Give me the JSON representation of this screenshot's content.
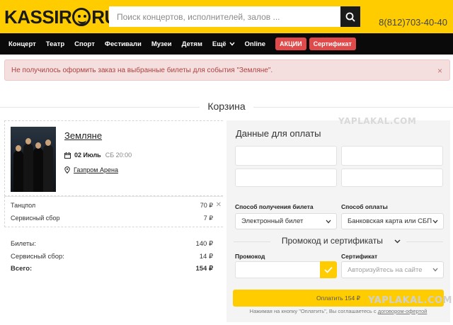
{
  "header": {
    "logo_left": "KASSIR",
    "logo_right": "RU",
    "search_placeholder": "Поиск концертов, исполнителей, залов ...",
    "phone": "8(812)703-40-40"
  },
  "nav": {
    "items": [
      "Концерт",
      "Театр",
      "Спорт",
      "Фестивали",
      "Музеи",
      "Детям",
      "Ещё",
      "Online"
    ],
    "tags": [
      "АКЦИИ",
      "Сертификат"
    ],
    "tag_color": "#e04a4a"
  },
  "alert": {
    "message": "Не получилось оформить заказ на выбранные билеты для события \"Земляне\".",
    "close": "×"
  },
  "cart": {
    "title": "Корзина",
    "event": {
      "name": "Земляне",
      "date": "02 Июль",
      "day_time": "СБ 20:00",
      "venue": "Газпром Арена"
    },
    "tickets": [
      {
        "label": "Танцпол",
        "value": "70 ₽"
      },
      {
        "label": "Сервисный сбор",
        "value": "7 ₽"
      }
    ],
    "totals": [
      {
        "label": "Билеты:",
        "value": "140 ₽"
      },
      {
        "label": "Сервисный сбор:",
        "value": "14 ₽"
      },
      {
        "label": "Всего:",
        "value": "154 ₽"
      }
    ]
  },
  "payment": {
    "title": "Данные для оплаты",
    "delivery_label": "Способ получения билета",
    "delivery_value": "Электронный билет",
    "method_label": "Способ оплаты",
    "method_value": "Банковская карта или СБП",
    "promo_section": "Промокод и сертификаты",
    "promo_label": "Промокод",
    "cert_label": "Сертификат",
    "cert_placeholder": "Авторизуйтесь на сайте",
    "pay_button": "Оплатить 154 ₽",
    "agree_text": "Нажимая на кнопку \"Оплатить\", Вы соглашаетесь с ",
    "agree_link": "договором-офертой"
  },
  "watermark": "YAPLAKAL.COM",
  "colors": {
    "accent": "#ffcc00",
    "nav_bg": "#0a0a0a",
    "alert_bg": "#f5dede"
  }
}
